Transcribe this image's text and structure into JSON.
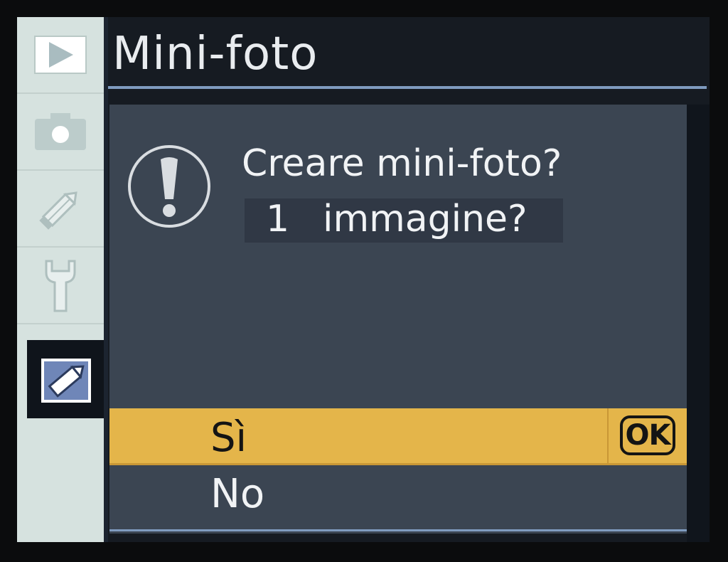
{
  "menu": {
    "tabs": [
      {
        "icon": "playback-icon"
      },
      {
        "icon": "shooting-icon"
      },
      {
        "icon": "custom-settings-pencil-icon"
      },
      {
        "icon": "setup-wrench-icon"
      },
      {
        "icon": "retouch-icon",
        "active": true
      }
    ]
  },
  "header": {
    "title": "Mini-foto"
  },
  "dialog": {
    "icon": "warning-icon",
    "question": "Creare mini-foto?",
    "count": "1",
    "count_label": "immagine?",
    "options": [
      {
        "label": "Sì",
        "selected": true,
        "badge": "OK"
      },
      {
        "label": "No",
        "selected": false
      }
    ]
  },
  "colors": {
    "highlight": "#e4b54a",
    "panel": "#3b4552",
    "sidebar": "#d6e2df",
    "accent_rule": "#7f9bbf"
  }
}
